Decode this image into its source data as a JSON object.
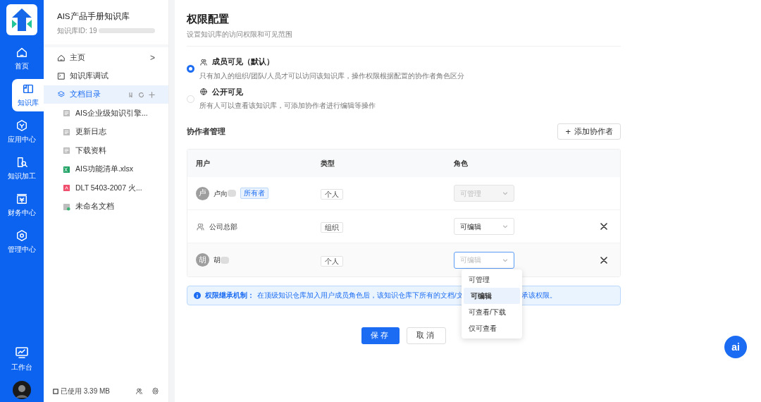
{
  "rail": {
    "items": [
      {
        "label": "首页",
        "selected": false
      },
      {
        "label": "知识库",
        "selected": true
      },
      {
        "label": "应用中心",
        "selected": false
      },
      {
        "label": "知识加工",
        "selected": false
      },
      {
        "label": "财务中心",
        "selected": false
      },
      {
        "label": "管理中心",
        "selected": false
      }
    ],
    "bottom": {
      "label": "工作台"
    }
  },
  "sidebar": {
    "title": "AIS产品手册知识库",
    "id_label": "知识库ID: 19",
    "nav": [
      {
        "label": "主页",
        "chevron": ">",
        "selected": false
      },
      {
        "label": "知识库调试",
        "selected": false
      },
      {
        "label": "文档目录",
        "selected": true
      }
    ],
    "docs": [
      {
        "label": "AIS企业级知识引擎...",
        "kind": "doc"
      },
      {
        "label": "更新日志",
        "kind": "doc"
      },
      {
        "label": "下载资料",
        "kind": "doc"
      },
      {
        "label": "AIS功能清单.xlsx",
        "kind": "excel"
      },
      {
        "label": "DLT 5403-2007 火...",
        "kind": "pdf"
      },
      {
        "label": "未命名文档",
        "kind": "note"
      }
    ],
    "usage": "已使用 3.39 MB"
  },
  "main": {
    "title": "权限配置",
    "subtitle": "设置知识库的访问权限和可见范围",
    "visibility": [
      {
        "title": "成员可见（默认）",
        "description": "只有加入的组织/团队/人员才可以访问该知识库，操作权限根据配置的协作者角色区分",
        "selected": true
      },
      {
        "title": "公开可见",
        "description": "所有人可以查看该知识库，可添加协作者进行编辑等操作",
        "selected": false
      }
    ],
    "section": "协作者管理",
    "add_button": "添加协作者",
    "add_icon": "+",
    "table": {
      "columns": [
        "用户",
        "类型",
        "角色"
      ],
      "rows": [
        {
          "kind": "person",
          "avatar": "卢",
          "name": "卢向",
          "badge": "所有者",
          "type": "个人",
          "role": "可管理",
          "disabled": true,
          "removable": false,
          "focused": false
        },
        {
          "kind": "org",
          "name": "公司总部",
          "type": "组织",
          "role": "可编辑",
          "disabled": false,
          "removable": true,
          "focused": false
        },
        {
          "kind": "person",
          "avatar": "胡",
          "name": "胡",
          "type": "个人",
          "role": "可编辑",
          "disabled": false,
          "removable": true,
          "focused": true
        }
      ]
    },
    "dropdown": [
      {
        "label": "可管理",
        "selected": false
      },
      {
        "label": "可编辑",
        "selected": true
      },
      {
        "label": "可查看/下载",
        "selected": false
      },
      {
        "label": "仅可查看",
        "selected": false
      }
    ],
    "notice": {
      "label": "权限继承机制：",
      "text_before": "在顶级知识仓库加入用户成员角色后，该知识仓库下所有的文档/文",
      "text_after": "承该权限。"
    },
    "buttons": [
      {
        "label": "保存",
        "primary": true
      },
      {
        "label": "取消",
        "primary": false
      }
    ],
    "assistant": "ai"
  }
}
